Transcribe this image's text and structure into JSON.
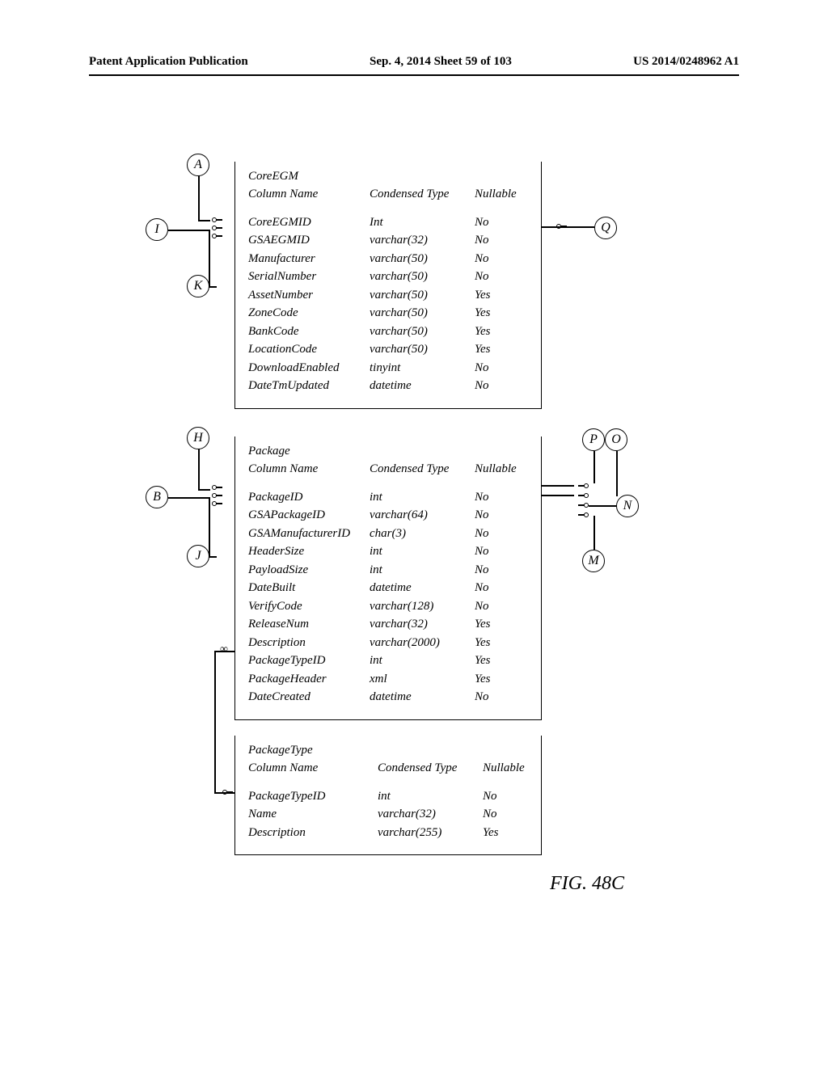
{
  "header": {
    "left": "Patent Application Publication",
    "center": "Sep. 4, 2014  Sheet 59 of 103",
    "right": "US 2014/0248962 A1"
  },
  "tables": {
    "coreEGM": {
      "title": "CoreEGM",
      "col1": "Column Name",
      "col2": "Condensed Type",
      "col3": "Nullable",
      "rows": [
        {
          "c1": "CoreEGMID",
          "c2": "Int",
          "c3": "No"
        },
        {
          "c1": "GSAEGMID",
          "c2": "varchar(32)",
          "c3": "No"
        },
        {
          "c1": "Manufacturer",
          "c2": "varchar(50)",
          "c3": "No"
        },
        {
          "c1": "SerialNumber",
          "c2": "varchar(50)",
          "c3": "No"
        },
        {
          "c1": "AssetNumber",
          "c2": "varchar(50)",
          "c3": "Yes"
        },
        {
          "c1": "ZoneCode",
          "c2": "varchar(50)",
          "c3": "Yes"
        },
        {
          "c1": "BankCode",
          "c2": "varchar(50)",
          "c3": "Yes"
        },
        {
          "c1": "LocationCode",
          "c2": "varchar(50)",
          "c3": "Yes"
        },
        {
          "c1": "DownloadEnabled",
          "c2": "tinyint",
          "c3": "No"
        },
        {
          "c1": "DateTmUpdated",
          "c2": "datetime",
          "c3": "No"
        }
      ]
    },
    "package": {
      "title": "Package",
      "col1": "Column Name",
      "col2": "Condensed Type",
      "col3": "Nullable",
      "rows": [
        {
          "c1": "PackageID",
          "c2": "int",
          "c3": "No"
        },
        {
          "c1": "GSAPackageID",
          "c2": "varchar(64)",
          "c3": "No"
        },
        {
          "c1": "GSAManufacturerID",
          "c2": "char(3)",
          "c3": "No"
        },
        {
          "c1": "HeaderSize",
          "c2": "int",
          "c3": "No"
        },
        {
          "c1": "PayloadSize",
          "c2": "int",
          "c3": "No"
        },
        {
          "c1": "DateBuilt",
          "c2": "datetime",
          "c3": "No"
        },
        {
          "c1": "VerifyCode",
          "c2": "varchar(128)",
          "c3": "No"
        },
        {
          "c1": "ReleaseNum",
          "c2": "varchar(32)",
          "c3": "Yes"
        },
        {
          "c1": "Description",
          "c2": "varchar(2000)",
          "c3": "Yes"
        },
        {
          "c1": "PackageTypeID",
          "c2": "int",
          "c3": "Yes"
        },
        {
          "c1": "PackageHeader",
          "c2": "xml",
          "c3": "Yes"
        },
        {
          "c1": "DateCreated",
          "c2": "datetime",
          "c3": "No"
        }
      ]
    },
    "packageType": {
      "title": "PackageType",
      "col1": "Column Name",
      "col2": "Condensed Type",
      "col3": "Nullable",
      "rows": [
        {
          "c1": "PackageTypeID",
          "c2": "int",
          "c3": "No"
        },
        {
          "c1": "Name",
          "c2": "varchar(32)",
          "c3": "No"
        },
        {
          "c1": "Description",
          "c2": "varchar(255)",
          "c3": "Yes"
        }
      ]
    }
  },
  "labels": {
    "A": "A",
    "B": "B",
    "H": "H",
    "I": "I",
    "J": "J",
    "K": "K",
    "M": "M",
    "N": "N",
    "O": "O",
    "P": "P",
    "Q": "Q"
  },
  "figLabel": "FIG. 48C",
  "infinity": "∞"
}
